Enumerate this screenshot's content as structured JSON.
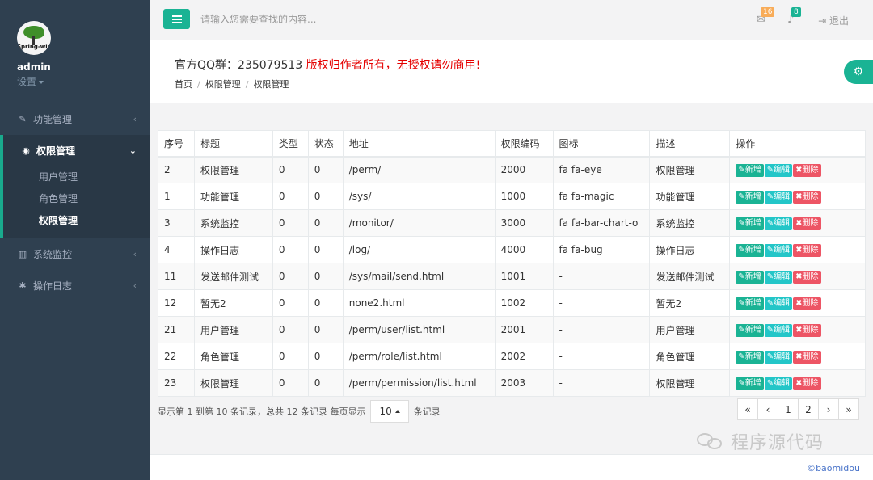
{
  "sidebar": {
    "username": "admin",
    "settings_label": "设置",
    "avatar_text": "Spring-wind",
    "menu": [
      {
        "label": "功能管理",
        "icon": "magic-wand-icon"
      },
      {
        "label": "权限管理",
        "icon": "eye-icon",
        "children": [
          "用户管理",
          "角色管理",
          "权限管理"
        ],
        "current": "权限管理"
      },
      {
        "label": "系统监控",
        "icon": "bar-chart-icon"
      },
      {
        "label": "操作日志",
        "icon": "bug-icon"
      }
    ]
  },
  "topbar": {
    "search_placeholder": "请输入您需要查找的内容...",
    "mail_count": "16",
    "bell_count": "8",
    "logout_label": "退出"
  },
  "heading": {
    "qq_label": "官方QQ群：235079513 ",
    "copyright": "版权归作者所有，无授权请勿商用!",
    "breadcrumb": [
      "首页",
      "权限管理",
      "权限管理"
    ]
  },
  "table": {
    "columns": [
      "序号",
      "标题",
      "类型",
      "状态",
      "地址",
      "权限编码",
      "图标",
      "描述",
      "操作"
    ],
    "rows": [
      [
        "2",
        "权限管理",
        "0",
        "0",
        "/perm/",
        "2000",
        "fa fa-eye",
        "权限管理"
      ],
      [
        "1",
        "功能管理",
        "0",
        "0",
        "/sys/",
        "1000",
        "fa fa-magic",
        "功能管理"
      ],
      [
        "3",
        "系统监控",
        "0",
        "0",
        "/monitor/",
        "3000",
        "fa fa-bar-chart-o",
        "系统监控"
      ],
      [
        "4",
        "操作日志",
        "0",
        "0",
        "/log/",
        "4000",
        "fa fa-bug",
        "操作日志"
      ],
      [
        "11",
        "发送邮件测试",
        "0",
        "0",
        "/sys/mail/send.html",
        "1001",
        "-",
        "发送邮件测试"
      ],
      [
        "12",
        "暂无2",
        "0",
        "0",
        "none2.html",
        "1002",
        "-",
        "暂无2"
      ],
      [
        "21",
        "用户管理",
        "0",
        "0",
        "/perm/user/list.html",
        "2001",
        "-",
        "用户管理"
      ],
      [
        "22",
        "角色管理",
        "0",
        "0",
        "/perm/role/list.html",
        "2002",
        "-",
        "角色管理"
      ],
      [
        "23",
        "权限管理",
        "0",
        "0",
        "/perm/permission/list.html",
        "2003",
        "-",
        "权限管理"
      ]
    ],
    "actions": {
      "add": "✎新增",
      "edit": "✎编辑",
      "delete": "✖删除"
    }
  },
  "pagination": {
    "info_prefix": "显示第 1 到第 10 条记录，总共 12 条记录 每页显示",
    "page_size": "10",
    "info_suffix": "条记录",
    "buttons": [
      "«",
      "‹",
      "1",
      "2",
      "›",
      "»"
    ]
  },
  "watermark": "程序源代码",
  "footer": {
    "copyright": "©baomidou"
  },
  "colors": {
    "accent": "#1ab394",
    "sidebar": "#2f4050",
    "danger": "#ed5565",
    "info": "#23c6c8"
  }
}
